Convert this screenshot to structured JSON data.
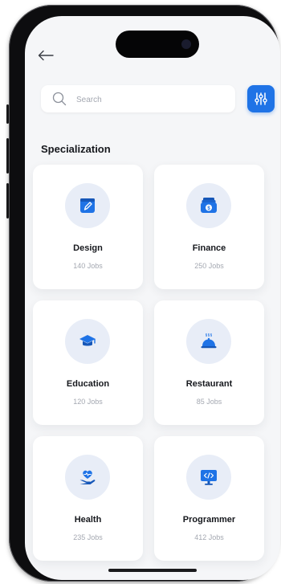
{
  "search": {
    "placeholder": "Search"
  },
  "section": {
    "title": "Specialization"
  },
  "categories": [
    {
      "title": "Design",
      "jobs": "140 Jobs",
      "icon": "design-icon"
    },
    {
      "title": "Finance",
      "jobs": "250 Jobs",
      "icon": "finance-icon"
    },
    {
      "title": "Education",
      "jobs": "120 Jobs",
      "icon": "education-icon"
    },
    {
      "title": "Restaurant",
      "jobs": "85 Jobs",
      "icon": "restaurant-icon"
    },
    {
      "title": "Health",
      "jobs": "235 Jobs",
      "icon": "health-icon"
    },
    {
      "title": "Programmer",
      "jobs": "412 Jobs",
      "icon": "programmer-icon"
    }
  ],
  "colors": {
    "accent": "#1f73e6",
    "icon_bg": "#e8edf7",
    "background": "#f5f6f8",
    "text_dark": "#16181d",
    "text_muted": "#a4a8b1"
  }
}
